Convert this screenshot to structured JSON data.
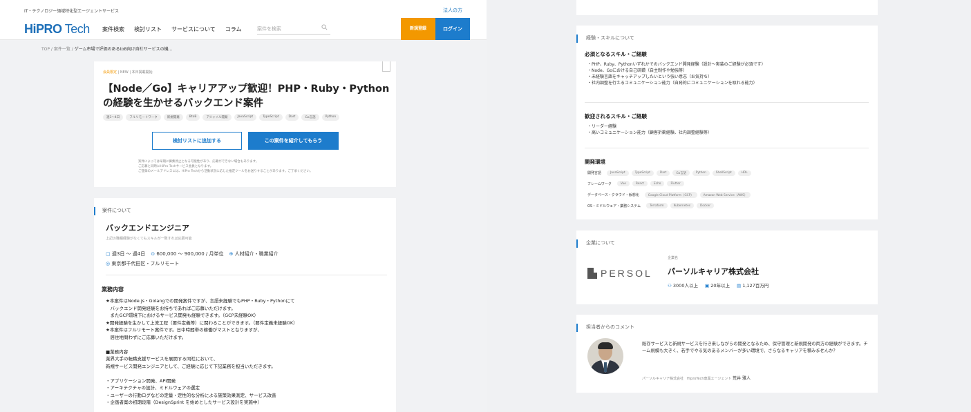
{
  "header": {
    "tagline": "IT・テクノロジー領域特化型エージェントサービス",
    "corporate_link": "法人の方",
    "logo_hipro": "HiPRO",
    "logo_tech": " Tech",
    "nav": [
      "案件検索",
      "検討リスト",
      "サービスについて",
      "コラム"
    ],
    "search_placeholder": "案件を検索",
    "signup": "新規登録",
    "login": "ログイン"
  },
  "breadcrumb": {
    "top": "TOP",
    "list": "案件一覧",
    "sep": " / ",
    "current": "ゲーム市場で評価のあるtoB向け自社サービスの機..."
  },
  "job_card": {
    "badge_limited": "会員限定",
    "badge_rest": "| NEW | 本日掲載開始",
    "title": "【Node／Go】キャリアアップ歓迎！PHP・Ruby・Pythonの経験を生かせるバックエンド案件",
    "tags": [
      "週3〜4日",
      "フルリモートワーク",
      "新規開発",
      "BtoB",
      "アジャイル開発",
      "JavaScript",
      "TypeScript",
      "Dart",
      "Go言語",
      "Python"
    ],
    "add_button": "検討リストに追加する",
    "intro_button": "この案件を紹介してもらう",
    "note1": "案件によっては早期に募集停止となる可能性があり、応募ができない場合もあります。",
    "note2": "ご応募と同時にHiPro Techサービス会員となります。",
    "note3": "ご登録のメールアドレスには、HiPro Techから活動状況に応じた推定ツールをお送りすることがあります。ご了承ください。"
  },
  "about": {
    "heading": "案件について",
    "job_title": "バックエンドエンジニア",
    "job_sub": "上記の職種経験がなくてもスキルが一致すれば応募可能",
    "days": "週3日 〜 週4日",
    "pay": "600,000 〜 900,000 / 月単位",
    "type": "人材紹介・職業紹介",
    "location": "東京都千代田区・フルリモート",
    "work_heading": "業務内容",
    "work_body": "★本案件はNode.js・Golangでの開発案件ですが、言語未経験でもPHP・Ruby・Pythonにて\n　バックエンド開発経験をお持ちであればご応募いただけます。\n　またGCP環境下におけるサービス開発も経験できます。（GCP未経験OK）\n★開発経験を生かして上流工程（要件定義等）に関わることができます。（要件定義未経験OK）\n★本案件はフルリモート案件です。日中時間帯の稼働がマストとなりますが、\n　居住地問わずにご応募いただけます。\n\n■業務内容\n業界大手の転職支援サービスを展開する同社において、\n新規サービス開発エンジニアとして、ご経験に応じて下記業務を担当いただきます。\n\n・アプリケーション開発、API開発\n・アーキテクチャの設計、ミドルウェアの選定\n・ユーザーの行動ログなどの定量・定性的な分析による施策効果測定、サービス改善\n・企画者案の初期段階（DesignSprint を始めとしたサービス設計を実施中）"
  },
  "skills": {
    "heading": "経験・スキルについて",
    "required_heading": "必須となるスキル・ご経験",
    "required_list": "・PHP、Ruby、Pythonいずれかでのバックエンド開発経験（設計〜実装のご経験が必須です）\n・Node、Goにおける自己研鑽（自主制作や勉強等）\n・未経験言語をキャッチアップしたいという強い意志（お気持ち）\n・社内調整を行えるコミュニケーション能力（自発的にコミュニケーションを取れる能力）",
    "welcome_heading": "歓迎されるスキル・ご経験",
    "welcome_list": "・リーダー経験\n・高いコミュニケーション能力（顧客折衝経験、社内調整経験等）",
    "env_heading": "開発環境",
    "env": [
      {
        "label": "開発言語",
        "items": [
          "JavaScript",
          "TypeScript",
          "Dart",
          "Go言語",
          "Python",
          "ShellScript",
          "HDL"
        ]
      },
      {
        "label": "フレームワーク",
        "items": [
          "Vue",
          "React",
          "Echo",
          "Flutter"
        ]
      },
      {
        "label": "データベース・クラウド・仮想化",
        "items": [
          "Google Cloud Platform（GCP）",
          "Amazon Web Service（AWS）"
        ]
      },
      {
        "label": "OS・ミドルウェア・業務システム",
        "items": [
          "Terraform",
          "Kubernetes",
          "Docker"
        ]
      }
    ]
  },
  "company": {
    "heading": "企業について",
    "logo_text": "PERSOL",
    "label": "企業名",
    "name": "パーソルキャリア株式会社",
    "employees": "3000人以上",
    "years": "20年以上",
    "capital": "1,127百万円"
  },
  "comment": {
    "heading": "担当者からのコメント",
    "text": "既存サービスと新規サービスを行き来しながらの開発となるため、保守管理と新規開発の両方の経験ができます。チーム規模も大きく、若手でやる気のあるメンバーが多い環境で、さらなるキャリアを積みませんか？",
    "sign": "パーソルキャリア株式会社　HiproTech専属エージェント",
    "name": "荒井 雅人"
  }
}
